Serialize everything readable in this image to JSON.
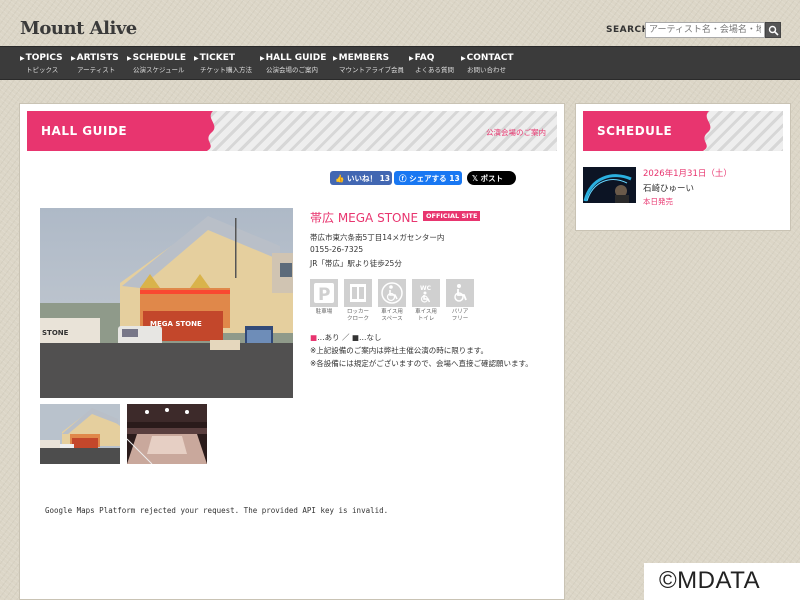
{
  "brand": {
    "logo": "Mount Alive"
  },
  "search": {
    "label": "SEARCH",
    "placeholder": "アーティスト名・会場名・地"
  },
  "nav": [
    {
      "en": "TOPICS",
      "jp": "トピックス"
    },
    {
      "en": "ARTISTS",
      "jp": "アーティスト"
    },
    {
      "en": "SCHEDULE",
      "jp": "公演スケジュール"
    },
    {
      "en": "TICKET",
      "jp": "チケット購入方法"
    },
    {
      "en": "HALL GUIDE",
      "jp": "公演会場のご案内"
    },
    {
      "en": "MEMBERS",
      "jp": "マウントアライブ会員"
    },
    {
      "en": "FAQ",
      "jp": "よくある質問"
    },
    {
      "en": "CONTACT",
      "jp": "お問い合わせ"
    }
  ],
  "hall_guide": {
    "title": "HALL GUIDE",
    "subtitle": "公演会場のご案内"
  },
  "social": {
    "like": "いいね！ 13",
    "share": "シェアする 13",
    "post": "ポスト"
  },
  "venue": {
    "name": "帯広 MEGA STONE",
    "badge": "OFFICIAL SITE",
    "address": "帯広市東六条南5丁目14メガセンター内",
    "phone": "0155-26-7325",
    "access": "JR「帯広」駅より徒歩25分",
    "sign_text": "MEGA STONE",
    "sign_text2": "STONE"
  },
  "facilities": [
    {
      "icon": "parking-icon",
      "label": "駐車場",
      "label2": ""
    },
    {
      "icon": "locker-icon",
      "label": "ロッカー",
      "label2": "クローク"
    },
    {
      "icon": "wheelchair-space-icon",
      "label": "車イス用",
      "label2": "スペース"
    },
    {
      "icon": "accessible-toilet-icon",
      "label": "車イス用",
      "label2": "トイレ"
    },
    {
      "icon": "barrier-free-icon",
      "label": "バリア",
      "label2": "フリー"
    }
  ],
  "legend": {
    "text": "…あり ／ ■…なし"
  },
  "notes": [
    "※上記設備のご案内は弊社主催公演の時に限ります。",
    "※各設備には規定がございますので、会場へ直接ご確認願います。"
  ],
  "map_error": "Google Maps Platform rejected your request. The provided API key is invalid.",
  "schedule": {
    "title": "SCHEDULE",
    "date": "2026年1月31日（土）",
    "artist": "石崎ひゅーい",
    "status": "本日発売"
  },
  "copyright": "©MDATA",
  "colors": {
    "accent": "#e8356f",
    "nav_bg": "#3b3b3b",
    "page_bg": "#dcd6c7"
  }
}
